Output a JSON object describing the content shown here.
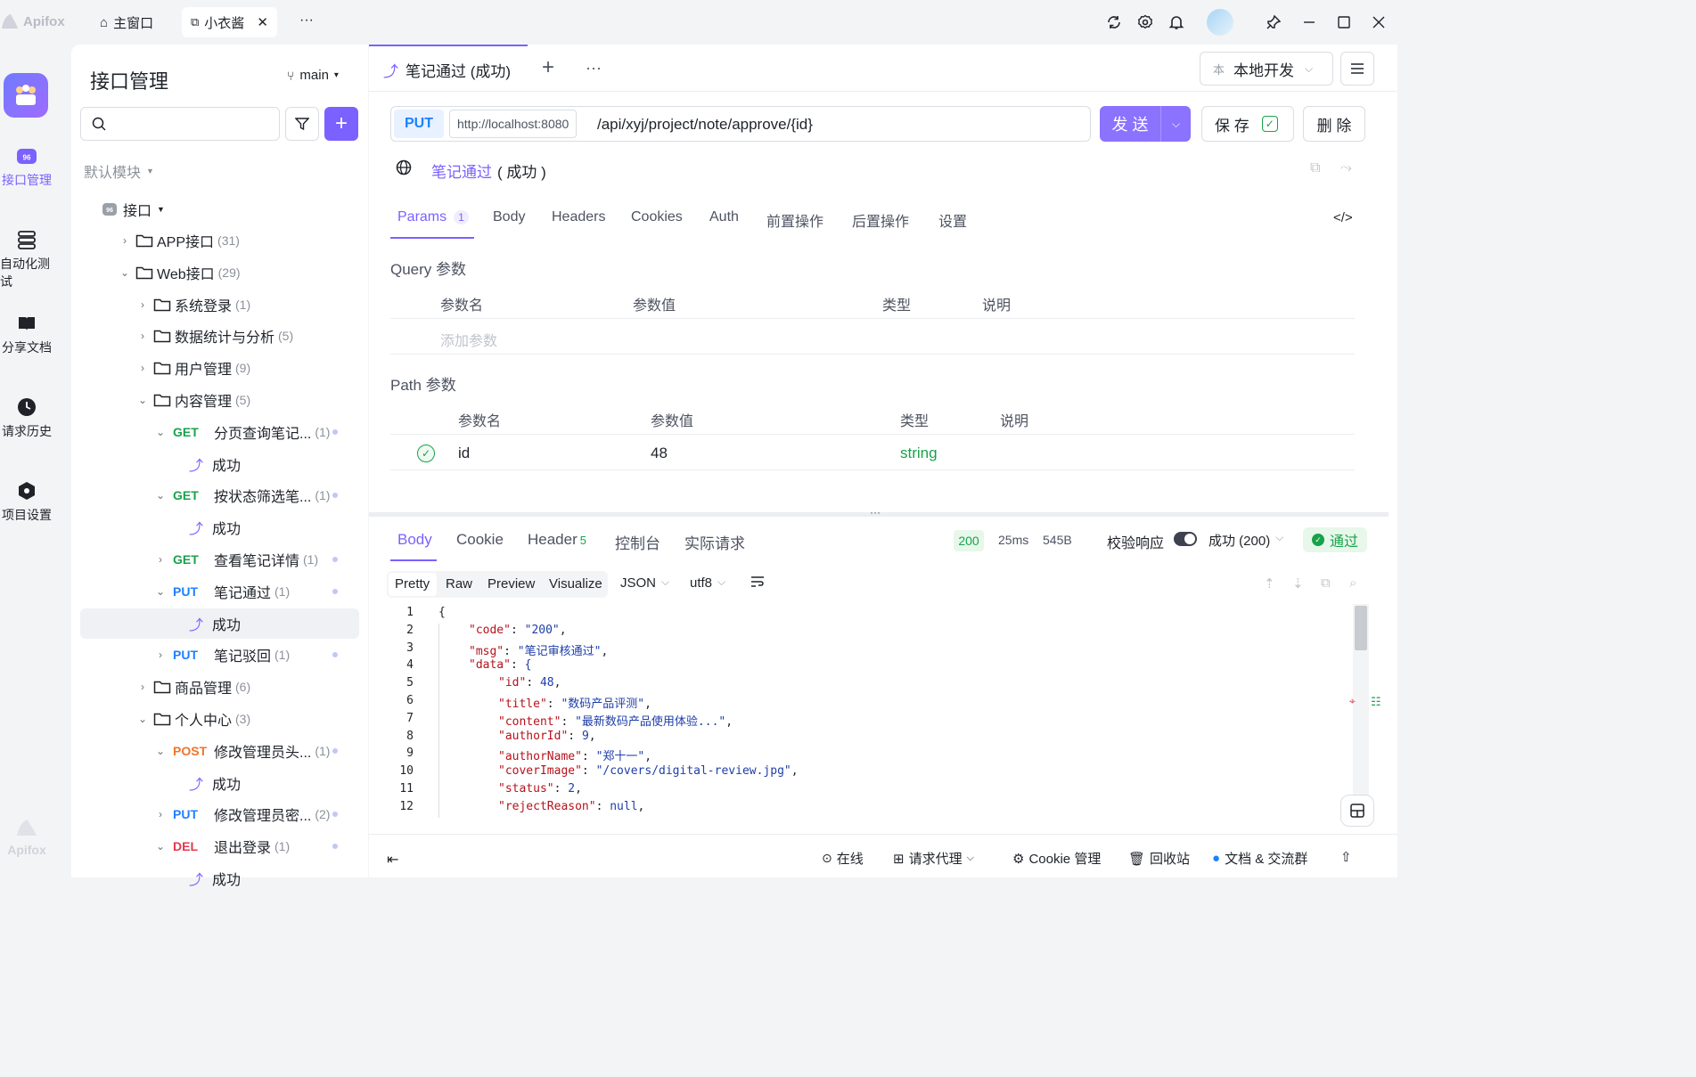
{
  "app": {
    "name": "Apifox"
  },
  "titlebar": {
    "tabs": [
      {
        "label": "主窗口"
      },
      {
        "label": "小衣酱"
      }
    ],
    "more": "···"
  },
  "rail": {
    "items": [
      {
        "label": "接口管理"
      },
      {
        "label": "自动化测试"
      },
      {
        "label": "分享文档"
      },
      {
        "label": "请求历史"
      },
      {
        "label": "项目设置"
      }
    ],
    "bottom_logo": "Apifox"
  },
  "tree": {
    "title": "接口管理",
    "branch": "main",
    "search_placeholder": "",
    "module": "默认模块",
    "root": "接口",
    "rows": [
      {
        "label": "APP接口",
        "count": "(31)"
      },
      {
        "label": "Web接口",
        "count": "(29)"
      },
      {
        "label": "系统登录",
        "count": "(1)"
      },
      {
        "label": "数据统计与分析",
        "count": "(5)"
      },
      {
        "label": "用户管理",
        "count": "(9)"
      },
      {
        "label": "内容管理",
        "count": "(5)"
      },
      {
        "method": "GET",
        "label": "分页查询笔记...",
        "count": "(1)"
      },
      {
        "label": "成功"
      },
      {
        "method": "GET",
        "label": "按状态筛选笔...",
        "count": "(1)"
      },
      {
        "label": "成功"
      },
      {
        "method": "GET",
        "label": "查看笔记详情",
        "count": "(1)"
      },
      {
        "method": "PUT",
        "label": "笔记通过",
        "count": "(1)"
      },
      {
        "label": "成功"
      },
      {
        "method": "PUT",
        "label": "笔记驳回",
        "count": "(1)"
      },
      {
        "label": "商品管理",
        "count": "(6)"
      },
      {
        "label": "个人中心",
        "count": "(3)"
      },
      {
        "method": "POST",
        "label": "修改管理员头...",
        "count": "(1)"
      },
      {
        "label": "成功"
      },
      {
        "method": "PUT",
        "label": "修改管理员密...",
        "count": "(2)"
      },
      {
        "method": "DEL",
        "label": "退出登录",
        "count": "(1)"
      },
      {
        "label": "成功"
      }
    ]
  },
  "main": {
    "tab_title": "笔记通过 (成功)",
    "env": {
      "badge": "本",
      "label": "本地开发"
    },
    "request": {
      "method": "PUT",
      "base": "http://localhost:8080",
      "path": "/api/xyj/project/note/approve/{id}",
      "send": "发 送",
      "save": "保 存",
      "delete": "删 除"
    },
    "name": {
      "label": "笔记通过",
      "suffix": "( 成功 )"
    },
    "param_tabs": [
      {
        "label": "Params",
        "badge": "1"
      },
      {
        "label": "Body"
      },
      {
        "label": "Headers"
      },
      {
        "label": "Cookies"
      },
      {
        "label": "Auth"
      },
      {
        "label": "前置操作"
      },
      {
        "label": "后置操作"
      },
      {
        "label": "设置"
      }
    ],
    "query": {
      "title": "Query 参数",
      "cols": [
        "参数名",
        "参数值",
        "类型",
        "说明"
      ],
      "add_placeholder": "添加参数"
    },
    "path_params": {
      "title": "Path 参数",
      "cols": [
        "参数名",
        "参数值",
        "类型",
        "说明"
      ],
      "row": {
        "name": "id",
        "value": "48",
        "type": "string"
      }
    },
    "response": {
      "tabs": [
        {
          "label": "Body"
        },
        {
          "label": "Cookie"
        },
        {
          "label": "Header",
          "badge": "5"
        },
        {
          "label": "控制台"
        },
        {
          "label": "实际请求"
        }
      ],
      "status": "200",
      "time": "25ms",
      "size": "545B",
      "validate_label": "校验响应",
      "validate_select": "成功 (200)",
      "pass": "通过",
      "view_tabs": [
        "Pretty",
        "Raw",
        "Preview",
        "Visualize"
      ],
      "format": "JSON",
      "encoding": "utf8"
    },
    "code_lines": [
      {
        "n": "1",
        "text": "{"
      },
      {
        "n": "2",
        "key": "\"code\"",
        "val": "\"200\"",
        "tail": ","
      },
      {
        "n": "3",
        "key": "\"msg\"",
        "val": "\"笔记审核通过\"",
        "tail": ","
      },
      {
        "n": "4",
        "key": "\"data\"",
        "val": "{",
        "tail": ""
      },
      {
        "n": "5",
        "key": "\"id\"",
        "val": "48",
        "tail": ","
      },
      {
        "n": "6",
        "key": "\"title\"",
        "val": "\"数码产品评测\"",
        "tail": ","
      },
      {
        "n": "7",
        "key": "\"content\"",
        "val": "\"最新数码产品使用体验...\"",
        "tail": ","
      },
      {
        "n": "8",
        "key": "\"authorId\"",
        "val": "9",
        "tail": ","
      },
      {
        "n": "9",
        "key": "\"authorName\"",
        "val": "\"郑十一\"",
        "tail": ","
      },
      {
        "n": "10",
        "key": "\"coverImage\"",
        "val": "\"/covers/digital-review.jpg\"",
        "tail": ","
      },
      {
        "n": "11",
        "key": "\"status\"",
        "val": "2",
        "tail": ","
      },
      {
        "n": "12",
        "key": "\"rejectReason\"",
        "val": "null",
        "tail": ","
      }
    ]
  },
  "footer": {
    "online": "在线",
    "proxy": "请求代理",
    "cookie": "Cookie 管理",
    "recycle": "回收站",
    "docs": "文档 & 交流群"
  },
  "colors": {
    "accent": "#7b61ff",
    "get": "#17a34a",
    "put": "#1e80ff",
    "post": "#f0742b",
    "del": "#e5384c"
  }
}
